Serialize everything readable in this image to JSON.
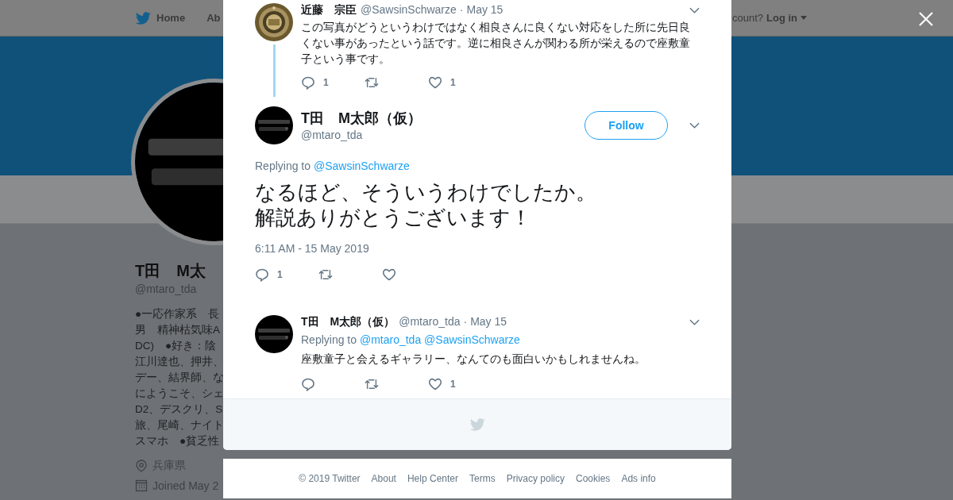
{
  "nav": {
    "home": "Home",
    "about": "Ab",
    "account_prompt": "count?",
    "login": "Log in"
  },
  "profile": {
    "name": "T田　M太",
    "handle": "@mtaro_tda",
    "bio": [
      "●一応作家系　長",
      "男　精神枯気味A",
      "DC)　●好き：陰",
      "江川達也、押井、",
      "デー、結界師、な",
      "にようこそ、シェ",
      "D2、デスクリ、S",
      "旅、尾崎、ナイト",
      "スマホ　●貧乏性"
    ],
    "location": "兵庫県",
    "joined": "Joined May 2"
  },
  "modal": {
    "parent_tweet": {
      "name": "近藤　宗臣",
      "handle": "@SawsinSchwarze",
      "separator": "·",
      "date": "May 15",
      "text": "この写真がどうというわけではなく相良さんに良くない対応をした所に先日良くない事があったという話です。逆に相良さんが関わる所が栄えるので座敷童子という事です。",
      "reply_count": "1",
      "like_count": "1"
    },
    "tweet": {
      "name": "T田　M太郎（仮）",
      "handle": "@mtaro_tda",
      "follow_button": "Follow",
      "replying_label": "Replying to",
      "replying_to": [
        "@SawsinSchwarze"
      ],
      "text_lines": [
        "なるほど、そういうわけでしたか。",
        "解説ありがとうございます！"
      ],
      "timestamp": "6:11 AM - 15 May 2019",
      "reply_count": "1"
    },
    "replies": [
      {
        "name": "T田　M太郎（仮）",
        "handle": "@mtaro_tda",
        "separator": "·",
        "date": "May 15",
        "replying_label": "Replying to",
        "replying_to": [
          "@mtaro_tda",
          "@SawsinSchwarze"
        ],
        "text": "座敷童子と会えるギャラリー、なんてのも面白いかもしれませんね。",
        "like_count": "1"
      }
    ]
  },
  "footer": {
    "links": [
      "© 2019 Twitter",
      "About",
      "Help Center",
      "Terms",
      "Privacy policy",
      "Cookies",
      "Ads info"
    ]
  }
}
